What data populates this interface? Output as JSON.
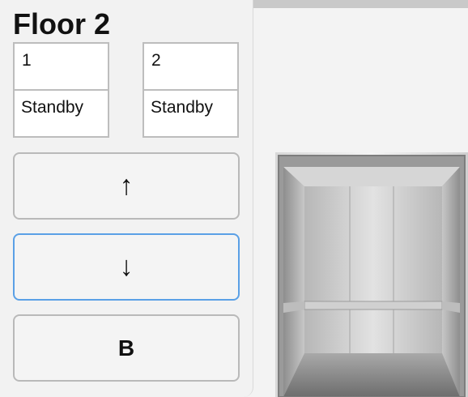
{
  "floor": {
    "title": "Floor 2"
  },
  "cars": [
    {
      "number": "1",
      "status": "Standby"
    },
    {
      "number": "2",
      "status": "Standby"
    }
  ],
  "buttons": {
    "up_label": "↑",
    "down_label": "↓",
    "basement_label": "B"
  },
  "colors": {
    "focus_border": "#5aa0e6",
    "panel_bg": "#f2f2f2"
  }
}
